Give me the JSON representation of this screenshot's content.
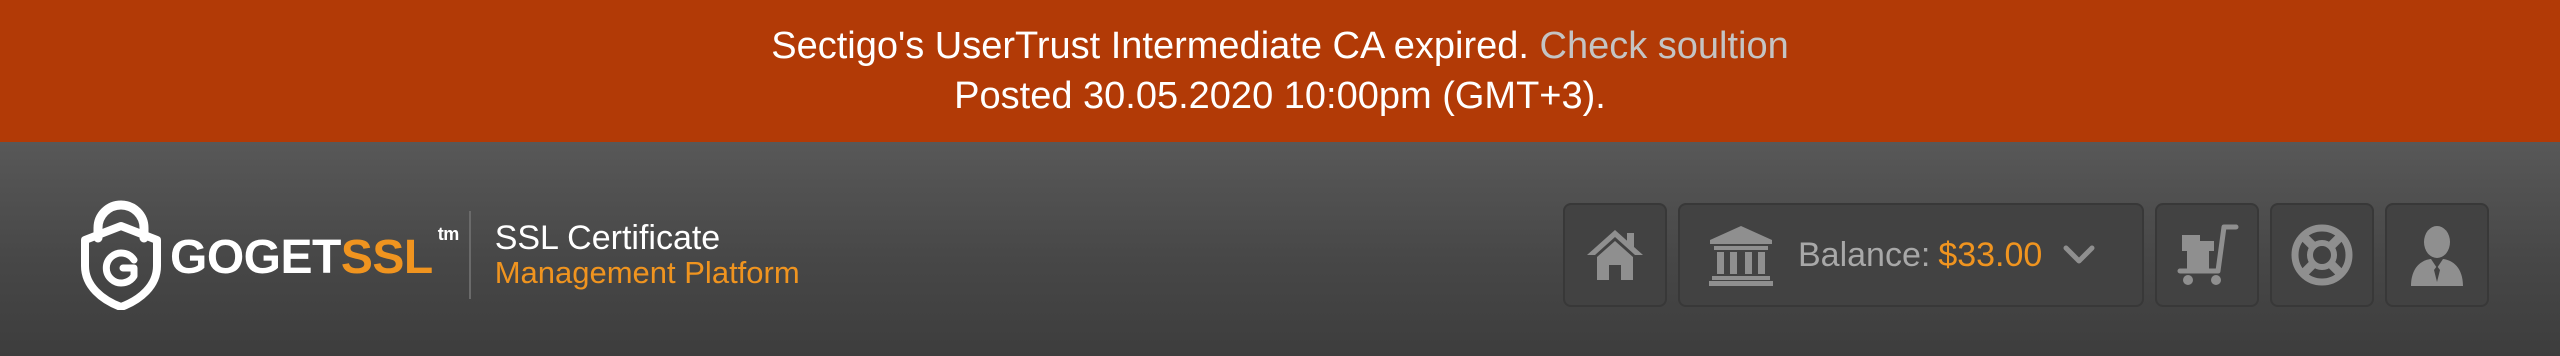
{
  "announcement": {
    "message": "Sectigo's UserTrust Intermediate CA expired.",
    "link_label": "Check soultion",
    "posted": "Posted 30.05.2020 10:00pm (GMT+3)."
  },
  "brand": {
    "logo_text_main": "GOGET",
    "logo_text_accent": "SSL",
    "logo_tm": "tm",
    "platform_line1": "SSL Certificate",
    "platform_line2": "Management Platform"
  },
  "toolbar": {
    "home_icon": "home-icon",
    "balance_icon": "bank-icon",
    "balance_label": "Balance:",
    "balance_value": "$33.00",
    "balance_dropdown_icon": "chevron-down-icon",
    "cart_icon": "cart-icon",
    "support_icon": "lifebuoy-icon",
    "account_icon": "user-icon"
  },
  "colors": {
    "alert_background": "#b23a06",
    "accent_orange": "#f0941f",
    "header_background": "#4a4a4a",
    "button_background": "#424242",
    "icon_gray": "#8f8f8f"
  }
}
